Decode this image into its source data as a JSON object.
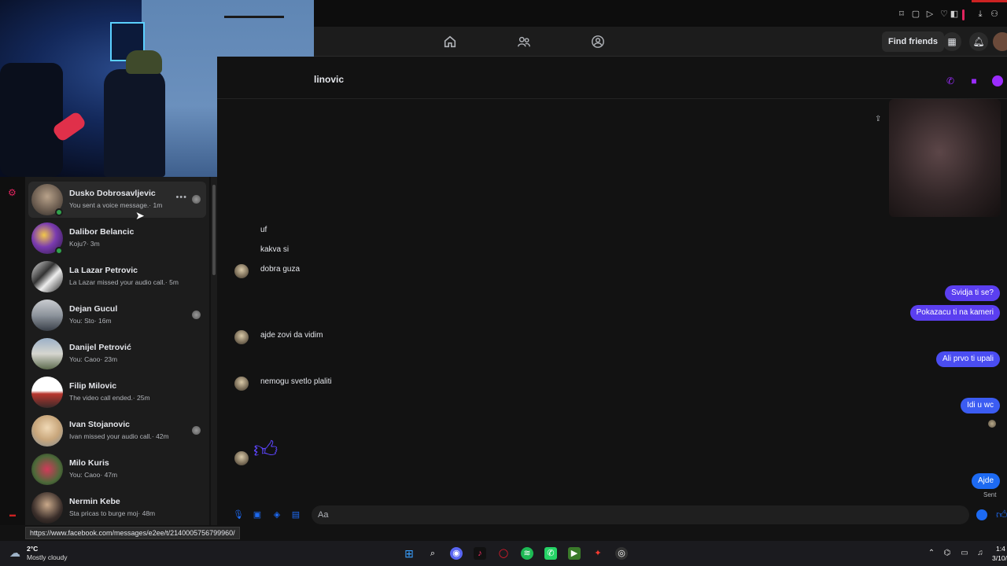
{
  "topbar": {
    "find_friends": "Find friends"
  },
  "conversation": {
    "name_partial": "linovic",
    "incoming": [
      "uf",
      "kakva si",
      "dobra guza",
      "ajde zovi da vidim",
      "nemogu svetlo plaliti"
    ],
    "outgoing": [
      "Svidja ti se?",
      "Pokazacu ti na kameri",
      "Ali prvo ti upali",
      "Idi u wc",
      "Ajde"
    ],
    "sent_label": "Sent",
    "composer_placeholder": "Aa"
  },
  "chats": [
    {
      "name": "Dusko Dobrosavljevic",
      "preview": "You sent a voice message.· 1m"
    },
    {
      "name": "Dalibor Belancic",
      "preview": "Koju?· 3m"
    },
    {
      "name": "La Lazar Petrovic",
      "preview": "La Lazar missed your audio call.· 5m"
    },
    {
      "name": "Dejan Gucul",
      "preview": "You: Sto· 16m"
    },
    {
      "name": "Danijel Petrović",
      "preview": "You: Caoo· 23m"
    },
    {
      "name": "Filip Milovic",
      "preview": "The video call ended.· 25m"
    },
    {
      "name": "Ivan Stojanovic",
      "preview": "Ivan missed your audio call.· 42m"
    },
    {
      "name": "Milo Kuris",
      "preview": "You: Caoo· 47m"
    },
    {
      "name": "Nermin Kebe",
      "preview": "Sta pricas to burge moj· 48m"
    }
  ],
  "status_url": "https://www.facebook.com/messages/e2ee/t/2140005756799960/",
  "taskbar": {
    "temperature": "2°C",
    "weather": "Mostly cloudy",
    "time": "1:4",
    "date": "3/10/"
  },
  "icons": {
    "nav": [
      "home-icon",
      "friends-icon",
      "groups-icon"
    ],
    "apps": [
      "windows-start-icon",
      "search-icon",
      "discord-icon",
      "tiktok-icon",
      "opera-icon",
      "spotify-icon",
      "whatsapp-icon",
      "app-icon",
      "app-icon",
      "chrome-icon"
    ]
  },
  "colors": {
    "messenger_purple": "#9b2cff",
    "outgoing_bubble": "#5b3ff0",
    "outgoing_bubble_blue": "#1d6af2",
    "online_green": "#31a24c"
  }
}
